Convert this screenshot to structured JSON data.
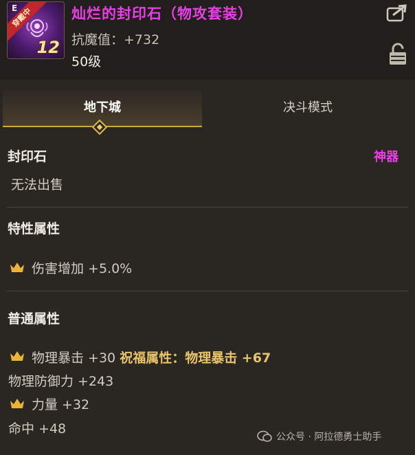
{
  "item": {
    "icon": {
      "grade": "E",
      "ribbon": "穿戴中",
      "level": "12",
      "emblem": "gem-emblem-icon"
    },
    "name": "灿烂的封印石（物攻套装）",
    "resist": "抗魔值：+732",
    "level": "50级",
    "name_color": "#e93fe6"
  },
  "header_actions": {
    "share": "share-icon",
    "lock": "lock-icon"
  },
  "tabs": [
    {
      "label": "地下城",
      "active": true
    },
    {
      "label": "决斗模式",
      "active": false
    }
  ],
  "type_section": {
    "title": "封印石",
    "rarity": "神器",
    "trade": "无法出售"
  },
  "special_section": {
    "title": "特性属性",
    "lines": [
      {
        "icon": "crown-icon",
        "text": "伤害增加 +5.0%"
      }
    ]
  },
  "normal_section": {
    "title": "普通属性",
    "lines": [
      {
        "icon": "crown-icon",
        "text": "物理暴击 +30",
        "extra": "祝福属性：物理暴击 +67"
      },
      {
        "icon": "",
        "text": "物理防御力 +243"
      },
      {
        "icon": "crown-icon",
        "text": "力量 +32"
      },
      {
        "icon": "",
        "text": "命中 +48"
      }
    ]
  },
  "watermark": "公众号 · 阿拉德勇士助手",
  "colors": {
    "background": "#2a2622",
    "epic": "#e93fe6",
    "gold": "#e9c46a",
    "tab_underline": "#d4a93a"
  }
}
